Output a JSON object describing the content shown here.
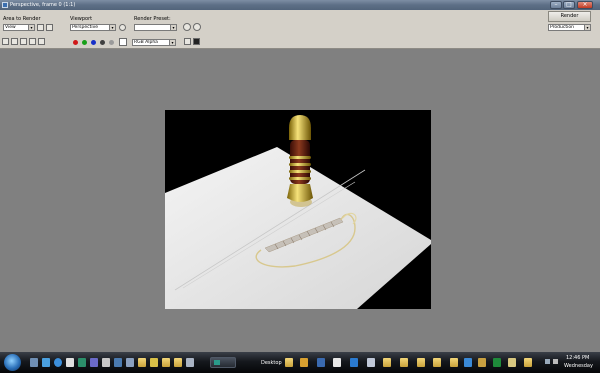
{
  "window": {
    "title": "Perspective, frame 0 (1:1)"
  },
  "toolbar": {
    "area_label": "Area to Render",
    "area_value": "View",
    "viewport_label": "Viewport",
    "viewport_value": "Perspective",
    "preset_label": "Render Preset:",
    "preset_value": "",
    "render_label": "Render",
    "render_mode": "Production",
    "channel_value": "RGB Alpha"
  },
  "taskbar": {
    "desktop_label": "Desktop",
    "clock_time": "12:46 PM",
    "clock_day": "Wednesday"
  },
  "colors": {
    "render_background": "#000000",
    "floor": "#e4e4e4",
    "workspace": "#808080"
  }
}
